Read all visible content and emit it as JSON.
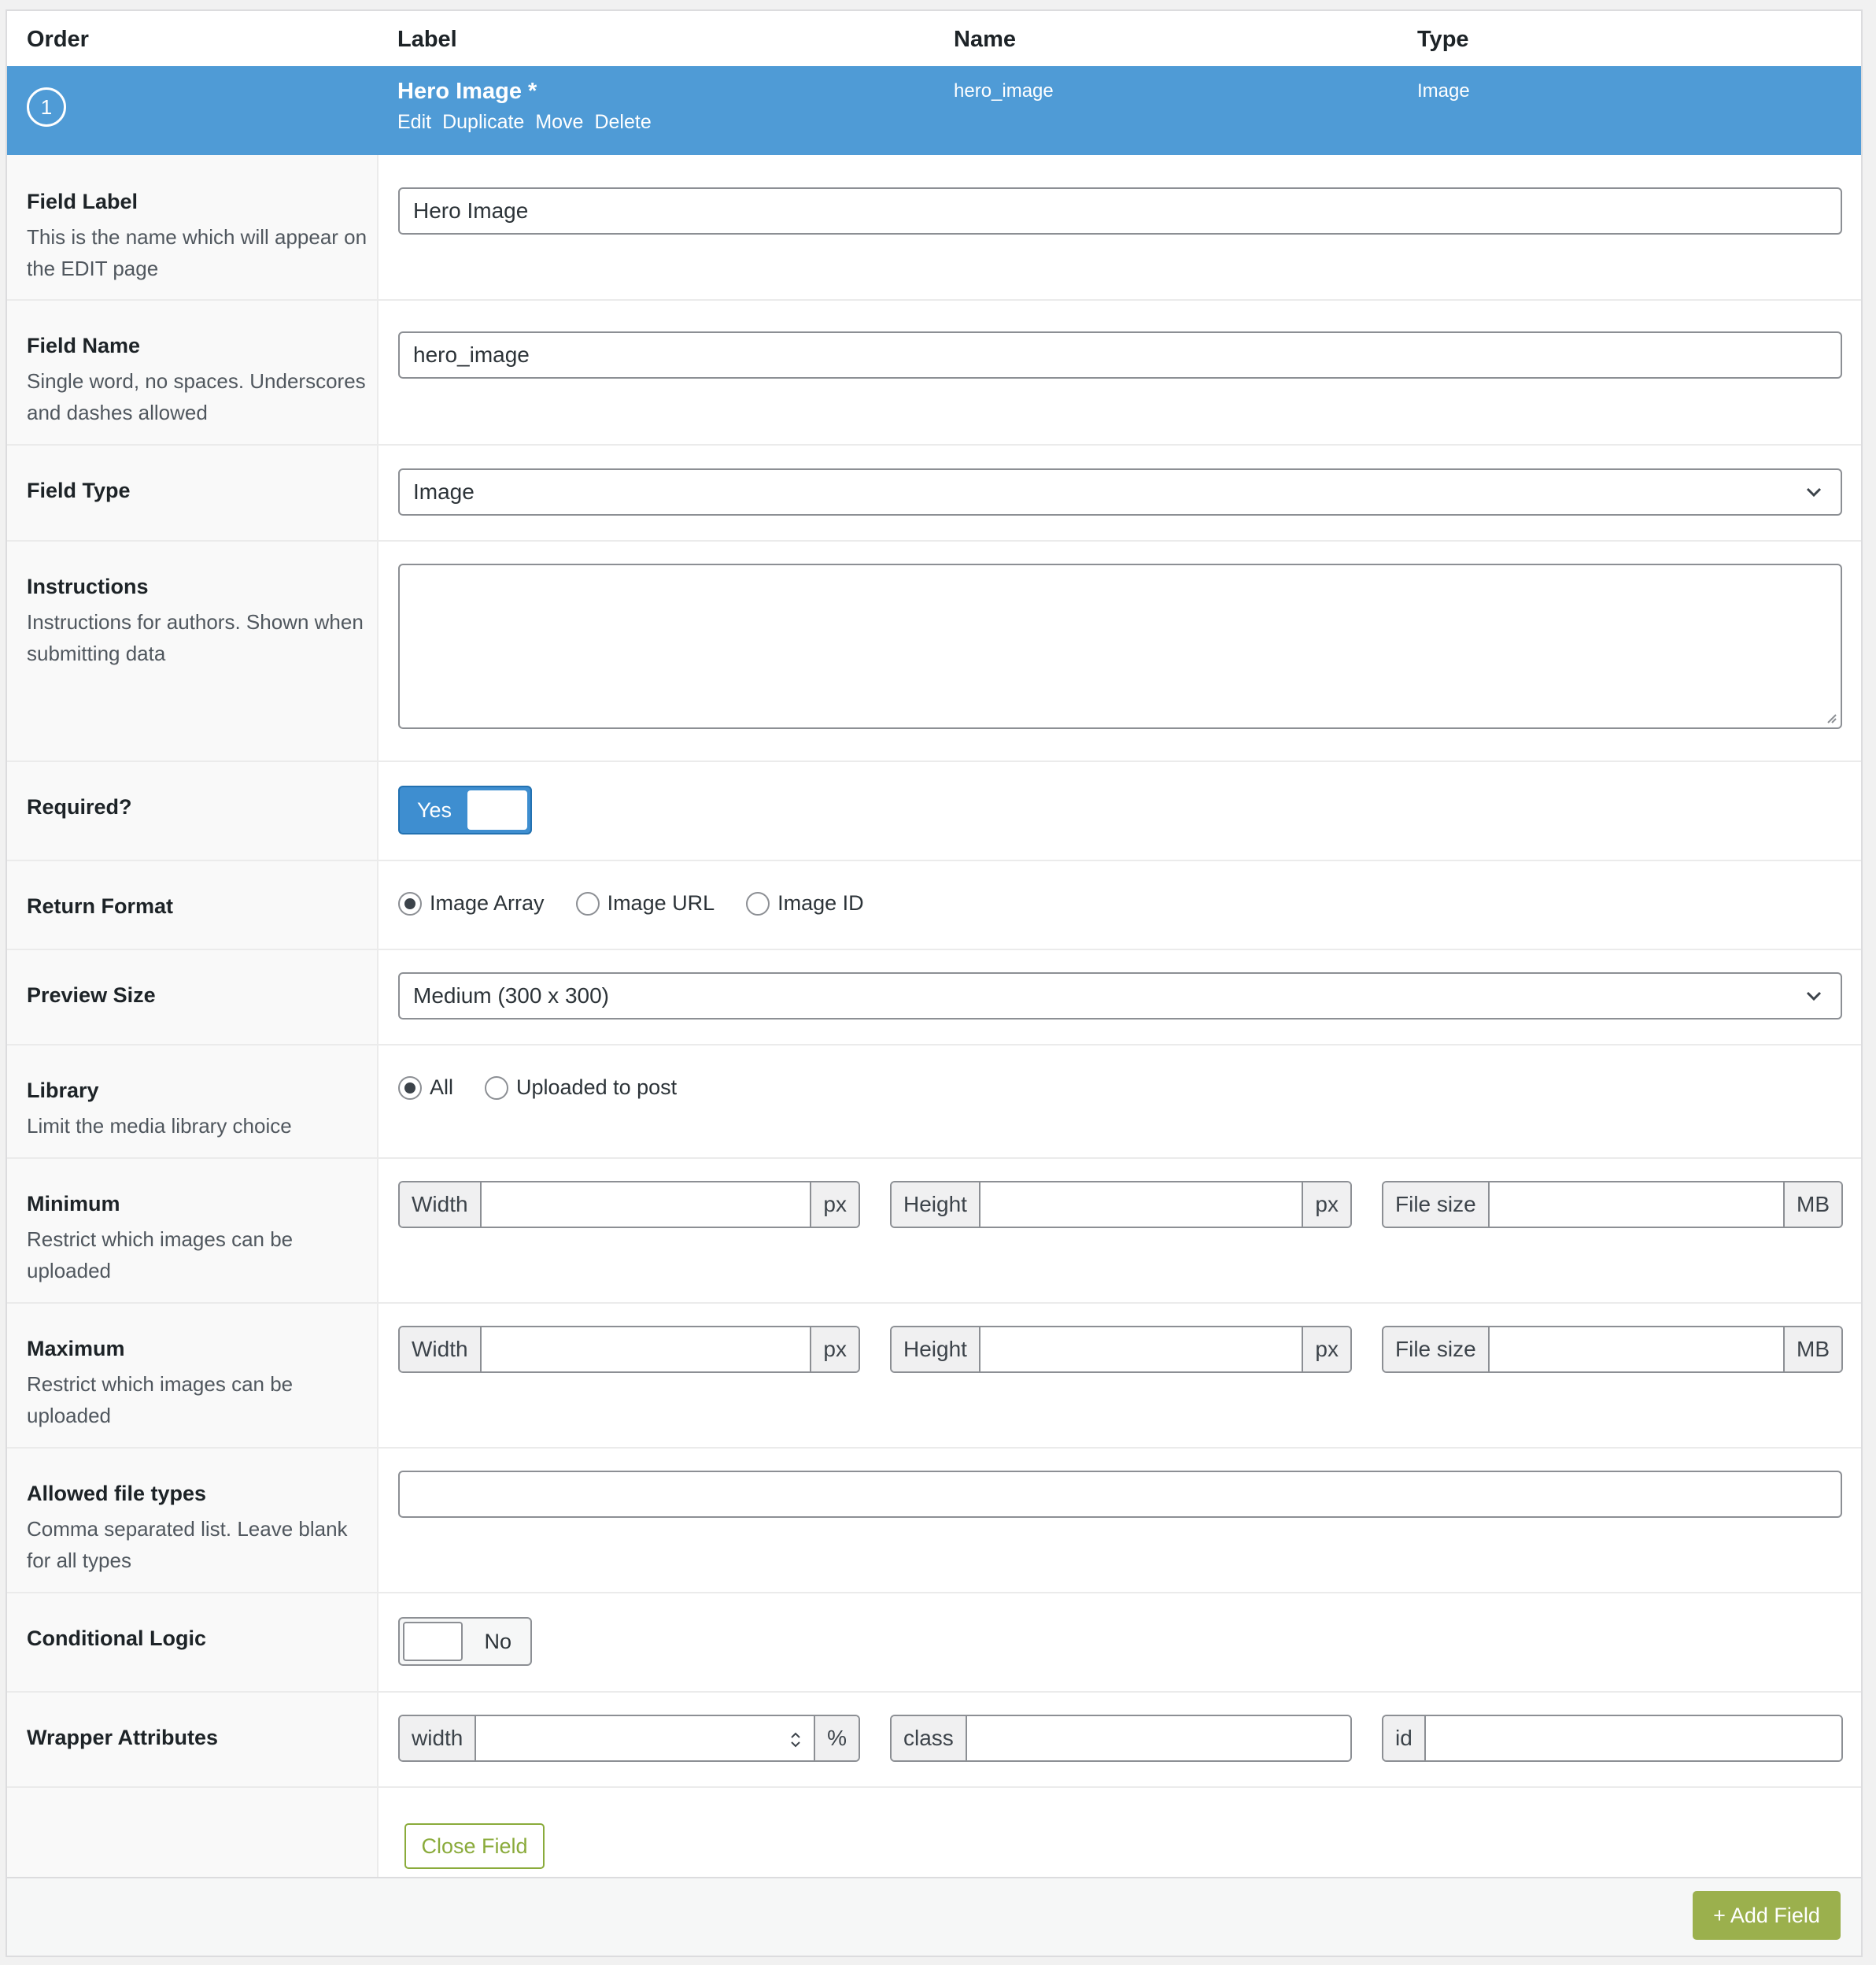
{
  "columns": {
    "order": "Order",
    "label": "Label",
    "name": "Name",
    "type": "Type"
  },
  "field": {
    "order": "1",
    "label": "Hero Image *",
    "actions": [
      "Edit",
      "Duplicate",
      "Move",
      "Delete"
    ],
    "name": "hero_image",
    "type": "Image"
  },
  "settings": {
    "field_label": {
      "label": "Field Label",
      "desc": "This is the name which will appear on the EDIT page",
      "value": "Hero Image"
    },
    "field_name": {
      "label": "Field Name",
      "desc": "Single word, no spaces. Underscores and dashes allowed",
      "value": "hero_image"
    },
    "field_type": {
      "label": "Field Type",
      "value": "Image"
    },
    "instructions": {
      "label": "Instructions",
      "desc": "Instructions for authors. Shown when submitting data",
      "value": ""
    },
    "required": {
      "label": "Required?",
      "toggle_label": "Yes",
      "on": true
    },
    "return_format": {
      "label": "Return Format",
      "options": [
        "Image Array",
        "Image URL",
        "Image ID"
      ],
      "selected": "Image Array"
    },
    "preview_size": {
      "label": "Preview Size",
      "value": "Medium (300 x 300)"
    },
    "library": {
      "label": "Library",
      "desc": "Limit the media library choice",
      "options": [
        "All",
        "Uploaded to post"
      ],
      "selected": "All"
    },
    "minimum": {
      "label": "Minimum",
      "desc": "Restrict which images can be uploaded",
      "width": "Width",
      "height": "Height",
      "file_size": "File size",
      "px": "px",
      "mb": "MB"
    },
    "maximum": {
      "label": "Maximum",
      "desc": "Restrict which images can be uploaded",
      "width": "Width",
      "height": "Height",
      "file_size": "File size",
      "px": "px",
      "mb": "MB"
    },
    "allowed_types": {
      "label": "Allowed file types",
      "desc": "Comma separated list. Leave blank for all types",
      "value": ""
    },
    "conditional_logic": {
      "label": "Conditional Logic",
      "toggle_label": "No",
      "on": false
    },
    "wrapper": {
      "label": "Wrapper Attributes",
      "width": "width",
      "percent": "%",
      "class": "class",
      "id": "id"
    }
  },
  "buttons": {
    "close_field": "Close Field",
    "add_field": "+ Add Field"
  },
  "colors": {
    "selected_row": "#4f9bd6",
    "toggle_on": "#3e8ed0",
    "button_green": "#9bb04d"
  }
}
